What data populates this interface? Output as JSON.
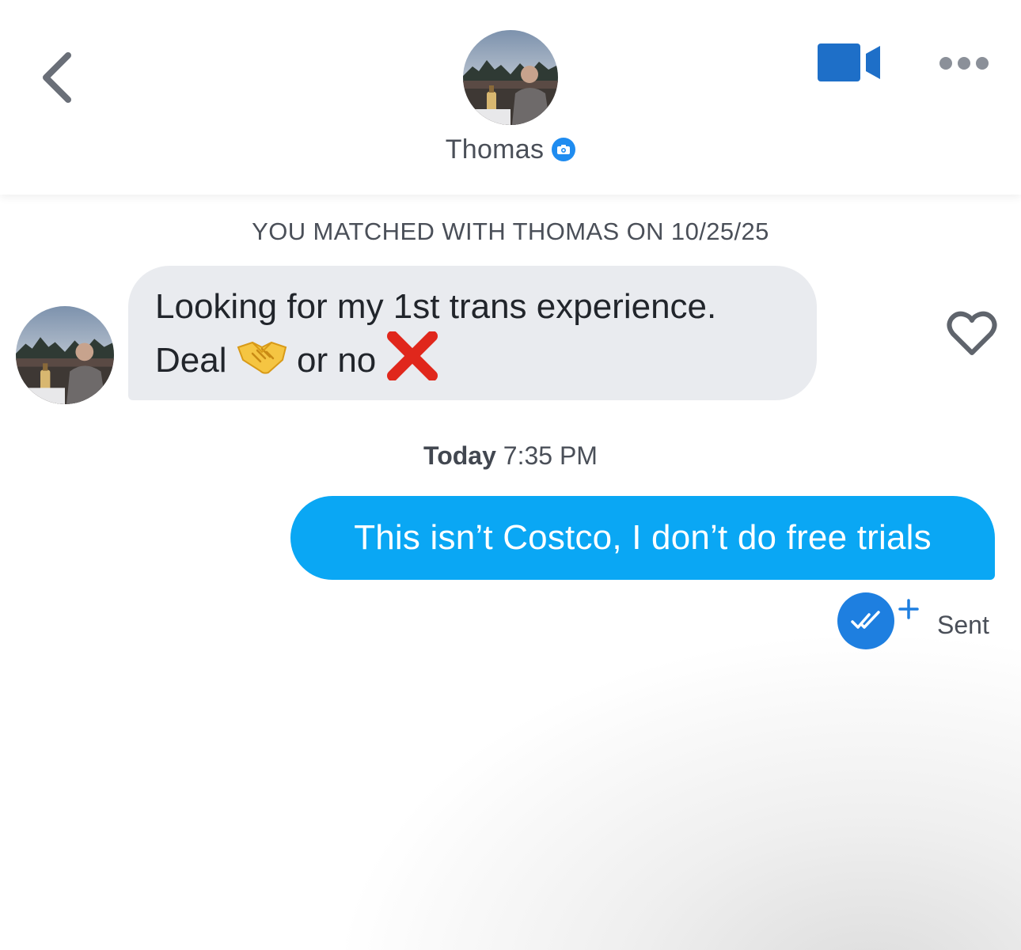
{
  "header": {
    "contact_name": "Thomas",
    "back_icon": "chevron-left-icon",
    "verified_icon": "camera-verified-icon",
    "video_icon": "video-camera-icon",
    "more_icon": "ellipsis-icon",
    "accent_color": "#1e7fe0"
  },
  "chat": {
    "match_banner": "YOU MATCHED WITH THOMAS ON 10/25/25",
    "incoming": {
      "line1": "Looking for my 1st trans experience.",
      "line2_word1": "Deal",
      "emoji1": "handshake-emoji",
      "line2_word2": "or no",
      "emoji2": "cross-mark-emoji",
      "bubble_color": "#e9ebef",
      "like_icon": "heart-outline-icon"
    },
    "timestamp_day": "Today",
    "timestamp_time": "7:35 PM",
    "outgoing": {
      "text": "This isn’t Costco, I don’t do free trials",
      "bubble_color": "#0aa7f4",
      "receipt_icon": "double-check-icon",
      "receipt_extra_icon": "plus-icon",
      "status": "Sent"
    }
  }
}
